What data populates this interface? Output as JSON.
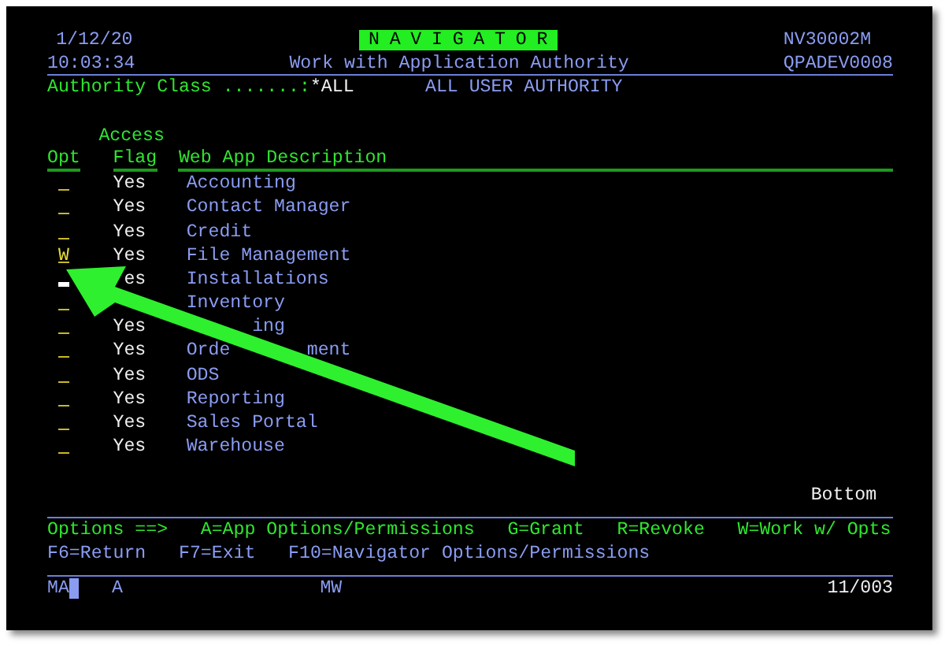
{
  "header": {
    "date": "1/12/20",
    "app_title": "NAVIGATOR",
    "program": "NV30002M",
    "time": "10:03:34",
    "screen_title": "Work with Application Authority",
    "device": "QPADEV0008"
  },
  "authority_class": {
    "label": "Authority Class .......:",
    "value": "*ALL",
    "description": "ALL USER AUTHORITY"
  },
  "columns": {
    "opt": "Opt",
    "flag_top": "Access",
    "flag": "Flag",
    "description": "Web App Description"
  },
  "rows": [
    {
      "opt": "",
      "cursor": false,
      "flag": [
        {
          "text": "Yes",
          "covered_before": false
        }
      ],
      "description": [
        {
          "text": "Accounting",
          "covered_before": false
        }
      ]
    },
    {
      "opt": "",
      "cursor": false,
      "flag": [
        {
          "text": "Yes",
          "covered_before": false
        }
      ],
      "description": [
        {
          "text": "Contact Manager",
          "covered_before": false
        }
      ]
    },
    {
      "opt": "",
      "cursor": false,
      "flag": [
        {
          "text": "Yes",
          "covered_before": false
        }
      ],
      "description": [
        {
          "text": "Credit",
          "covered_before": false
        }
      ]
    },
    {
      "opt": "W",
      "cursor": false,
      "flag": [
        {
          "text": "Yes",
          "covered_before": false
        }
      ],
      "description": [
        {
          "text": "File Management",
          "covered_before": false
        }
      ]
    },
    {
      "opt": "",
      "cursor": true,
      "flag": [
        {
          "text": "es",
          "covered_before": true
        }
      ],
      "description": [
        {
          "text": "Installations",
          "covered_before": false
        }
      ]
    },
    {
      "opt": "",
      "cursor": false,
      "description": [
        {
          "text": "Inventory",
          "covered_before": false
        }
      ]
    },
    {
      "opt": "",
      "cursor": false,
      "flag": [
        {
          "text": "Yes",
          "covered_before": false
        }
      ],
      "description": [
        {
          "text": "ing",
          "covered_before": true
        }
      ]
    },
    {
      "opt": "",
      "cursor": false,
      "flag": [
        {
          "text": "Yes",
          "covered_before": false
        }
      ],
      "description": [
        {
          "text": "Orde",
          "covered_before": false
        },
        {
          "text": "ment",
          "covered_before": true
        }
      ]
    },
    {
      "opt": "",
      "cursor": false,
      "flag": [
        {
          "text": "Yes",
          "covered_before": false
        }
      ],
      "description": [
        {
          "text": "ODS",
          "covered_before": false
        }
      ]
    },
    {
      "opt": "",
      "cursor": false,
      "flag": [
        {
          "text": "Yes",
          "covered_before": false
        }
      ],
      "description": [
        {
          "text": "Reporting",
          "covered_before": false
        }
      ]
    },
    {
      "opt": "",
      "cursor": false,
      "flag": [
        {
          "text": "Yes",
          "covered_before": false
        }
      ],
      "description": [
        {
          "text": "Sales Portal",
          "covered_before": false
        }
      ]
    },
    {
      "opt": "",
      "cursor": false,
      "flag": [
        {
          "text": "Yes",
          "covered_before": false
        }
      ],
      "description": [
        {
          "text": "Warehouse",
          "covered_before": false
        }
      ]
    }
  ],
  "position_indicator": "Bottom",
  "options_line": {
    "label": "Options ==>",
    "items": [
      "A=App Options/Permissions",
      "G=Grant",
      "R=Revoke",
      "W=Work w/ Opts"
    ]
  },
  "function_keys": [
    "F6=Return",
    "F7=Exit",
    "F10=Navigator Options/Permissions"
  ],
  "status_bar": {
    "mode": "MA",
    "field_1": "A",
    "field_2": "MW",
    "cursor_position": "11/003"
  }
}
